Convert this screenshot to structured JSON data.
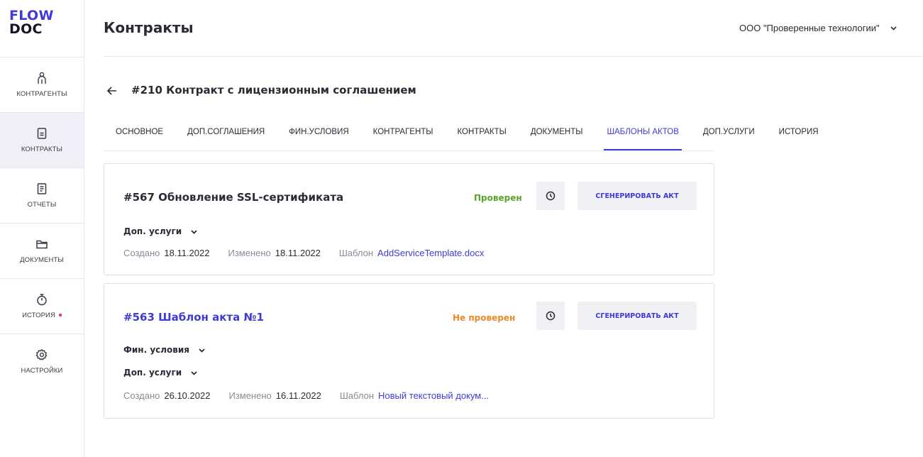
{
  "logo": {
    "line1": "FLOW",
    "line2": "DOC"
  },
  "sidebar": {
    "items": [
      {
        "label": "КОНТРАГЕНТЫ",
        "icon": "person-icon"
      },
      {
        "label": "КОНТРАКТЫ",
        "icon": "contract-icon",
        "active": true
      },
      {
        "label": "ОТЧЕТЫ",
        "icon": "report-icon"
      },
      {
        "label": "ДОКУМЕНТЫ",
        "icon": "folder-icon"
      },
      {
        "label": "ИСТОРИЯ",
        "icon": "stopwatch-icon",
        "badge": "dot"
      },
      {
        "label": "НАСТРОЙКИ",
        "icon": "gear-icon"
      }
    ]
  },
  "header": {
    "title": "Контракты",
    "organization": "ООО \"Проверенные технологии\""
  },
  "contract": {
    "title": "#210 Контракт с лицензионным соглашением"
  },
  "tabs": [
    {
      "label": "ОСНОВНОЕ"
    },
    {
      "label": "ДОП.СОГЛАШЕНИЯ"
    },
    {
      "label": "ФИН.УСЛОВИЯ"
    },
    {
      "label": "КОНТРАГЕНТЫ"
    },
    {
      "label": "КОНТРАКТЫ"
    },
    {
      "label": "ДОКУМЕНТЫ"
    },
    {
      "label": "ШАБЛОНЫ АКТОВ",
      "active": true
    },
    {
      "label": "ДОП.УСЛУГИ"
    },
    {
      "label": "ИСТОРИЯ"
    }
  ],
  "templates": [
    {
      "title": "#567 Обновление SSL-сертификата",
      "status": "Проверен",
      "status_color": "#5aa528",
      "title_color": "#2b2b36",
      "generate_label": "СГЕНЕРИРОВАТЬ АКТ",
      "groups": [
        "Доп. услуги"
      ],
      "created_label": "Создано",
      "created": "18.11.2022",
      "modified_label": "Изменено",
      "modified": "18.11.2022",
      "template_label": "Шаблон",
      "template": "AddServiceTemplate.docx"
    },
    {
      "title": "#563 Шаблон акта №1",
      "status": "Не проверен",
      "status_color": "#ef8a2a",
      "title_color": "#3f3ad8",
      "generate_label": "СГЕНЕРИРОВАТЬ АКТ",
      "groups": [
        "Фин. условия",
        "Доп. услуги"
      ],
      "created_label": "Создано",
      "created": "26.10.2022",
      "modified_label": "Изменено",
      "modified": "16.11.2022",
      "template_label": "Шаблон",
      "template": "Новый текстовый докум..."
    }
  ],
  "colors": {
    "accent": "#3f3ad8",
    "verified": "#5aa528",
    "unverified": "#ef8a2a",
    "badge": "#e2345a"
  }
}
